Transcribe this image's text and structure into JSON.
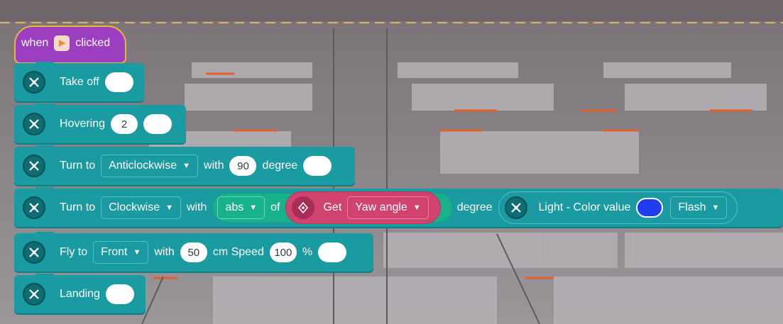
{
  "hat": {
    "when": "when",
    "clicked": "clicked",
    "icon": "play-flag-icon"
  },
  "blocks": {
    "take_off": {
      "label": "Take off"
    },
    "hovering": {
      "label": "Hovering",
      "value": "2"
    },
    "turn1": {
      "label": "Turn to",
      "direction": "Anticlockwise",
      "with": "with",
      "value": "90",
      "unit": "degree"
    },
    "turn2": {
      "label": "Turn to",
      "direction": "Clockwise",
      "with": "with",
      "abs": "abs",
      "of": "of",
      "get": "Get",
      "sensor": "Yaw angle",
      "unit": "degree",
      "light_label": "Light - Color value",
      "light_color": "#1f3cf0",
      "mode": "Flash"
    },
    "fly": {
      "label": "Fly to",
      "direction": "Front",
      "with": "with",
      "distance": "50",
      "speed_label": "cm Speed",
      "speed": "100",
      "percent": "%"
    },
    "landing": {
      "label": "Landing"
    }
  },
  "colors": {
    "block": "#1a9aa1",
    "hat": "#9b3fc0",
    "get": "#d0436f",
    "abs": "#17b18c"
  }
}
